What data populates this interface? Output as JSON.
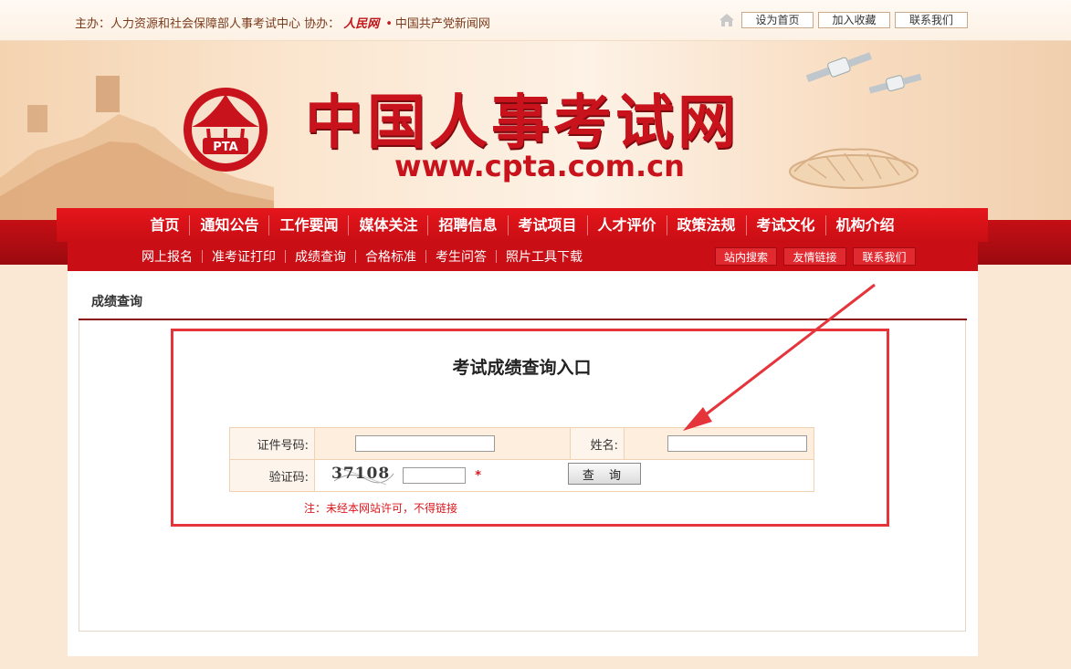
{
  "topbar": {
    "sponsor_label": "主办：",
    "sponsor_name": "人力资源和社会保障部人事考试中心",
    "co_label": "协办：",
    "co_logo": "人民网",
    "co_dot": "•",
    "co_site": "中国共产党新闻网",
    "links": [
      "设为首页",
      "加入收藏",
      "联系我们"
    ]
  },
  "banner": {
    "emblem_text": "PTA",
    "title": "中国人事考试网",
    "url": "www.cpta.com.cn"
  },
  "main_nav": [
    "首页",
    "通知公告",
    "工作要闻",
    "媒体关注",
    "招聘信息",
    "考试项目",
    "人才评价",
    "政策法规",
    "考试文化",
    "机构介绍"
  ],
  "sub_nav": {
    "links": [
      "网上报名",
      "准考证打印",
      "成绩查询",
      "合格标准",
      "考生问答",
      "照片工具下载"
    ],
    "buttons": [
      "站内搜索",
      "友情链接",
      "联系我们"
    ]
  },
  "section": {
    "title": "成绩查询"
  },
  "form": {
    "title": "考试成绩查询入口",
    "id_label": "证件号码:",
    "id_value": "",
    "name_label": "姓名:",
    "name_value": "",
    "captcha_label": "验证码:",
    "captcha_text": "37108",
    "captcha_value": "",
    "required_mark": "*",
    "submit_label": "查 询",
    "notice": "注：未经本网站许可，不得链接"
  },
  "colors": {
    "brand_red": "#c8121c",
    "nav_red": "#e5161c",
    "annotation_red": "#e6343b"
  }
}
